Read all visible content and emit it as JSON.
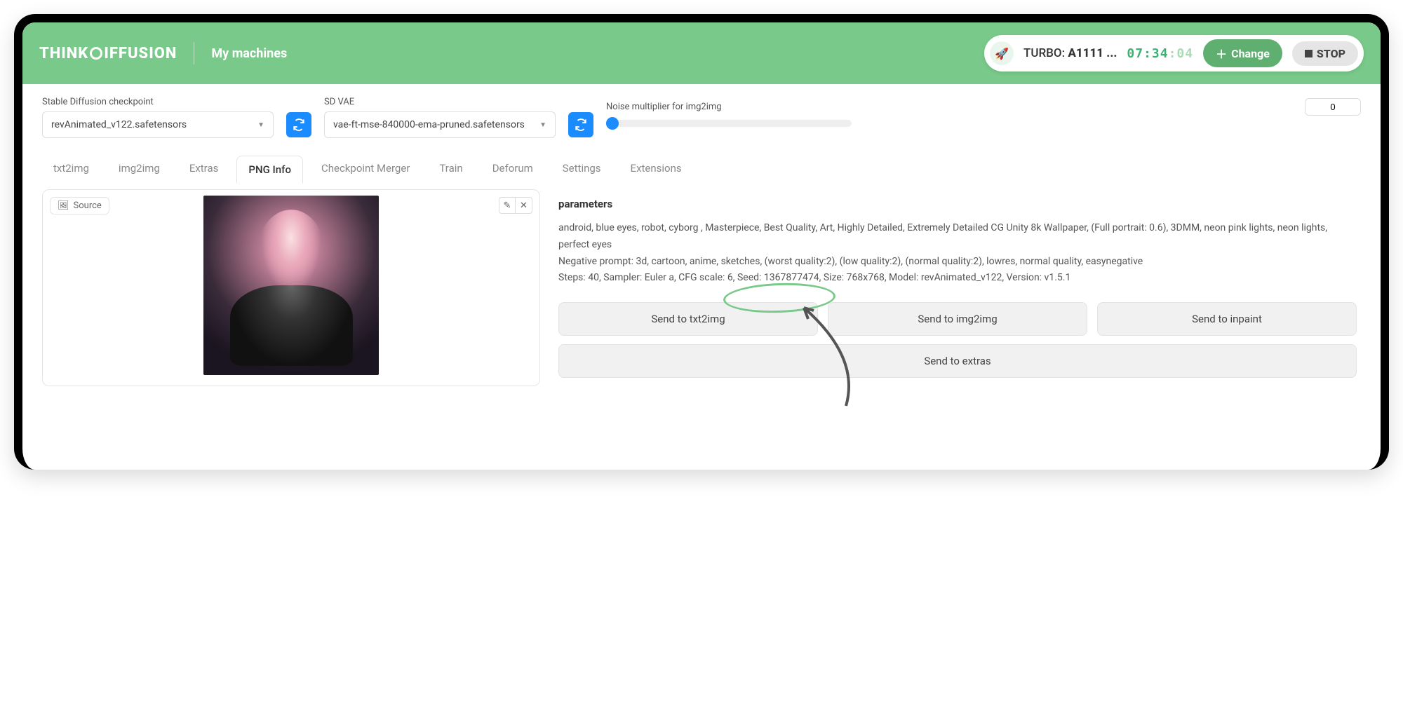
{
  "header": {
    "logo_text": "THINKDIFFUSION",
    "subtitle": "My machines",
    "turbo_label": "TURBO:",
    "turbo_value": "A1111 ...",
    "clock_hm": "07:34",
    "clock_s": ":04",
    "change_label": "Change",
    "stop_label": "STOP"
  },
  "controls": {
    "checkpoint_label": "Stable Diffusion checkpoint",
    "checkpoint_value": "revAnimated_v122.safetensors",
    "vae_label": "SD VAE",
    "vae_value": "vae-ft-mse-840000-ema-pruned.safetensors",
    "noise_label": "Noise multiplier for img2img",
    "noise_value": "0"
  },
  "tabs": [
    "txt2img",
    "img2img",
    "Extras",
    "PNG Info",
    "Checkpoint Merger",
    "Train",
    "Deforum",
    "Settings",
    "Extensions"
  ],
  "active_tab": "PNG Info",
  "source_label": "Source",
  "parameters": {
    "title": "parameters",
    "prompt": "android, blue eyes, robot, cyborg , Masterpiece, Best Quality, Art, Highly Detailed, Extremely Detailed CG Unity 8k Wallpaper, (Full portrait: 0.6), 3DMM, neon pink lights, neon lights, perfect eyes",
    "negative": "Negative prompt: 3d, cartoon, anime, sketches, (worst quality:2), (low quality:2), (normal quality:2), lowres, normal quality, easynegative",
    "meta": "Steps: 40, Sampler: Euler a, CFG scale: 6, Seed: 1367877474, Size: 768x768, Model: revAnimated_v122, Version: v1.5.1"
  },
  "buttons": {
    "send_txt2img": "Send to txt2img",
    "send_img2img": "Send to img2img",
    "send_inpaint": "Send to inpaint",
    "send_extras": "Send to extras"
  }
}
